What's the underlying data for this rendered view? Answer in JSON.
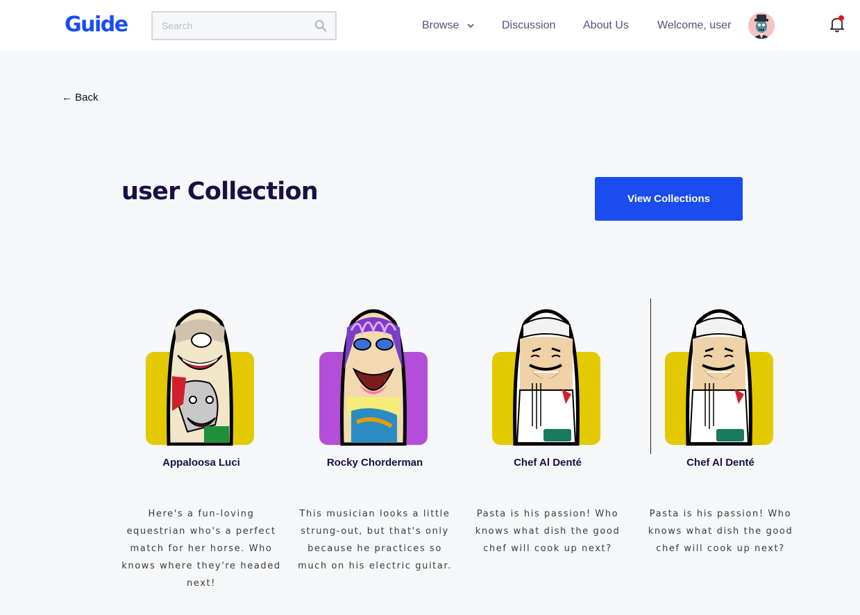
{
  "header": {
    "logo": "Guide",
    "search": {
      "placeholder": "Search",
      "value": ""
    },
    "nav": [
      {
        "label": "Browse",
        "has_dropdown": true
      },
      {
        "label": "Discussion"
      },
      {
        "label": "About Us"
      }
    ],
    "welcome": "Welcome, user",
    "notification_badge_color": "#e8141b"
  },
  "back_label": "← Back",
  "page_title": "user Collection",
  "view_collections_label": "View Collections",
  "colors": {
    "accent": "#1a4cf0",
    "title": "#1a0f45",
    "background": "#f6f7f8"
  },
  "cards": [
    {
      "name": "Appaloosa Luci",
      "description": "Here's a fun-loving equestrian who's a perfect match for her horse. Who knows where they're headed next!",
      "bg_color": "#e2c900"
    },
    {
      "name": "Rocky Chorderman",
      "description": "This musician looks a little strung-out, but that's only because he practices so much on his electric guitar.",
      "bg_color": "#b44ed8"
    },
    {
      "name": "Chef Al Denté",
      "description": "Pasta is his passion! Who knows what dish the good chef will cook up next?",
      "bg_color": "#e2c900"
    },
    {
      "name": "Chef Al Denté",
      "description": "Pasta is his passion! Who knows what dish the good chef will cook up next?",
      "bg_color": "#e2c900"
    }
  ]
}
